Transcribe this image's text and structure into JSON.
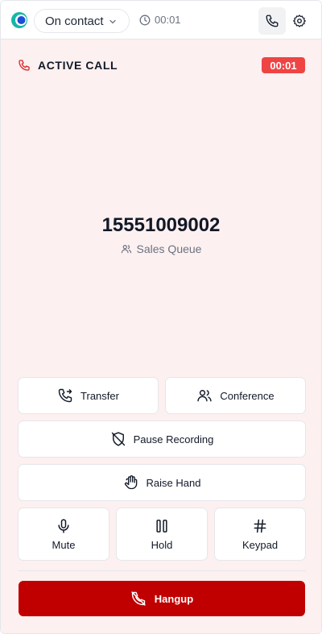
{
  "header": {
    "status": "On contact",
    "timer": "00:01"
  },
  "call": {
    "label": "ACTIVE CALL",
    "duration": "00:01",
    "number": "15551009002",
    "queue": "Sales Queue"
  },
  "actions": {
    "transfer": "Transfer",
    "conference": "Conference",
    "pause_recording": "Pause Recording",
    "raise_hand": "Raise Hand",
    "mute": "Mute",
    "hold": "Hold",
    "keypad": "Keypad",
    "hangup": "Hangup"
  },
  "colors": {
    "accent_red": "#ef4444",
    "hangup_red": "#c00000",
    "panel_bg": "#fdf0f0"
  }
}
